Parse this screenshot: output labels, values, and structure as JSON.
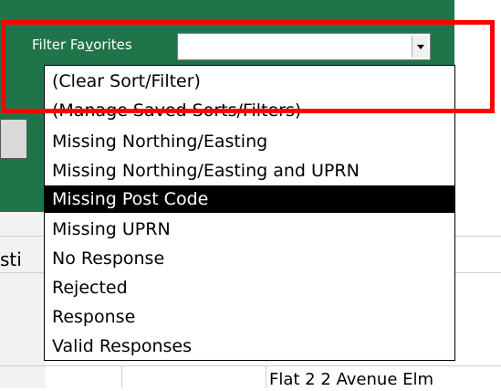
{
  "filter": {
    "label_pre": "Filter Fa",
    "label_access_key": "v",
    "label_post": "orites",
    "current_value": ""
  },
  "dropdown": {
    "items": [
      "(Clear Sort/Filter)",
      "(Manage Saved Sorts/Filters)",
      "Missing Northing/Easting",
      "Missing Northing/Easting and UPRN",
      "Missing Post Code",
      "Missing UPRN",
      "No Response",
      "Rejected",
      "Response",
      "Valid Responses"
    ],
    "selected_index": 4
  },
  "background": {
    "partial_column_text": "sti",
    "partial_cell_text": "Flat 2 2 Avenue Elm"
  },
  "colors": {
    "panel_green": "#20744a",
    "highlight_red": "#ff0000",
    "selected_bg": "#000000"
  }
}
